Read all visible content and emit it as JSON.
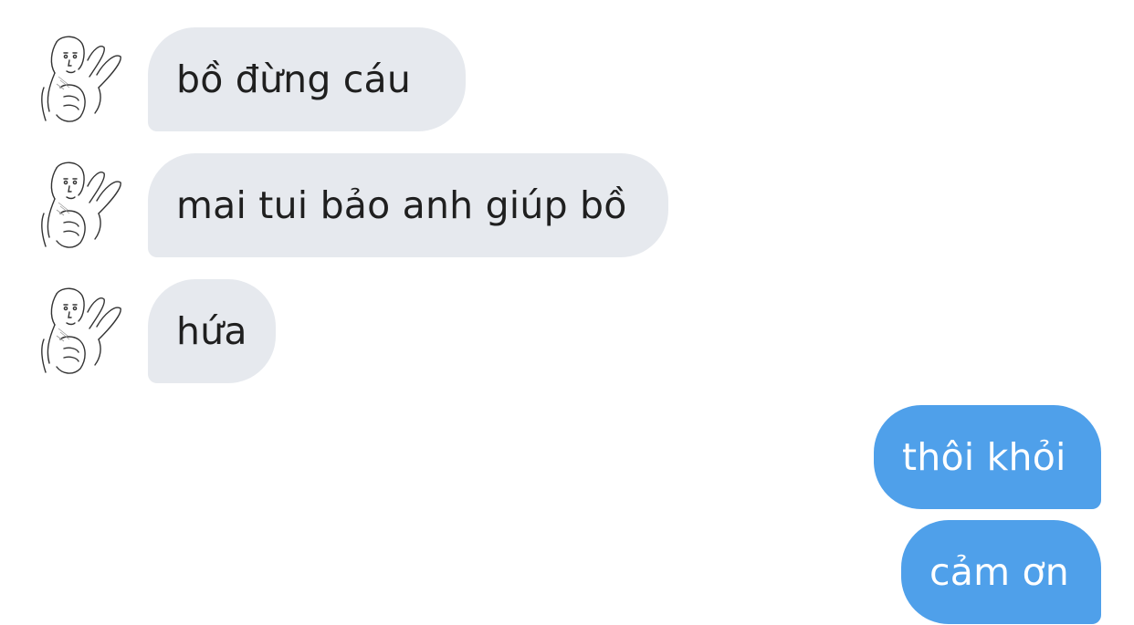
{
  "conversation": {
    "messages": [
      {
        "sender": "other",
        "text": "bồ đừng cáu"
      },
      {
        "sender": "other",
        "text": "mai tui bảo anh giúp bồ"
      },
      {
        "sender": "other",
        "text": "hứa"
      },
      {
        "sender": "me",
        "text": "thôi khỏi"
      },
      {
        "sender": "me",
        "text": "cảm ơn"
      }
    ]
  },
  "theme": {
    "incoming_bubble_color": "#e6e9ee",
    "outgoing_bubble_color": "#4fa0ea",
    "avatar_icon": "meme-peace-sign-face-icon"
  }
}
